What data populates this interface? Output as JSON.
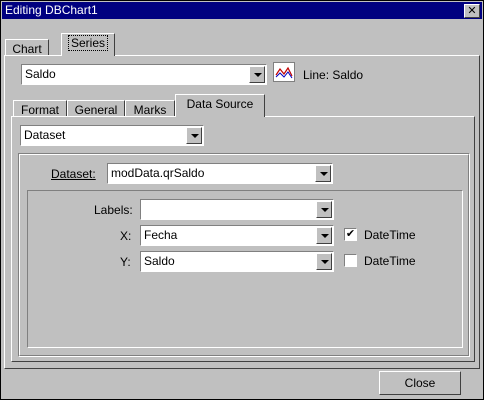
{
  "window": {
    "title": "Editing DBChart1",
    "close_glyph": "✕"
  },
  "top_tabs": [
    {
      "label": "Chart"
    },
    {
      "label": "Series"
    }
  ],
  "series_select": {
    "value": "Saldo"
  },
  "series_info": {
    "icon": "line-chart-icon",
    "label": "Line: Saldo"
  },
  "sub_tabs": [
    {
      "label": "Format"
    },
    {
      "label": "General"
    },
    {
      "label": "Marks"
    },
    {
      "label": "Data Source"
    }
  ],
  "source_type": {
    "value": "Dataset"
  },
  "dataset": {
    "label": "Dataset:",
    "value": "modData.qrSaldo"
  },
  "fields": {
    "labels": {
      "label": "Labels:",
      "value": ""
    },
    "x": {
      "label": "X:",
      "value": "Fecha",
      "datetime_label": "DateTime",
      "datetime_checked": true
    },
    "y": {
      "label": "Y:",
      "value": "Saldo",
      "datetime_label": "DateTime",
      "datetime_checked": false
    }
  },
  "buttons": {
    "close": "Close"
  }
}
